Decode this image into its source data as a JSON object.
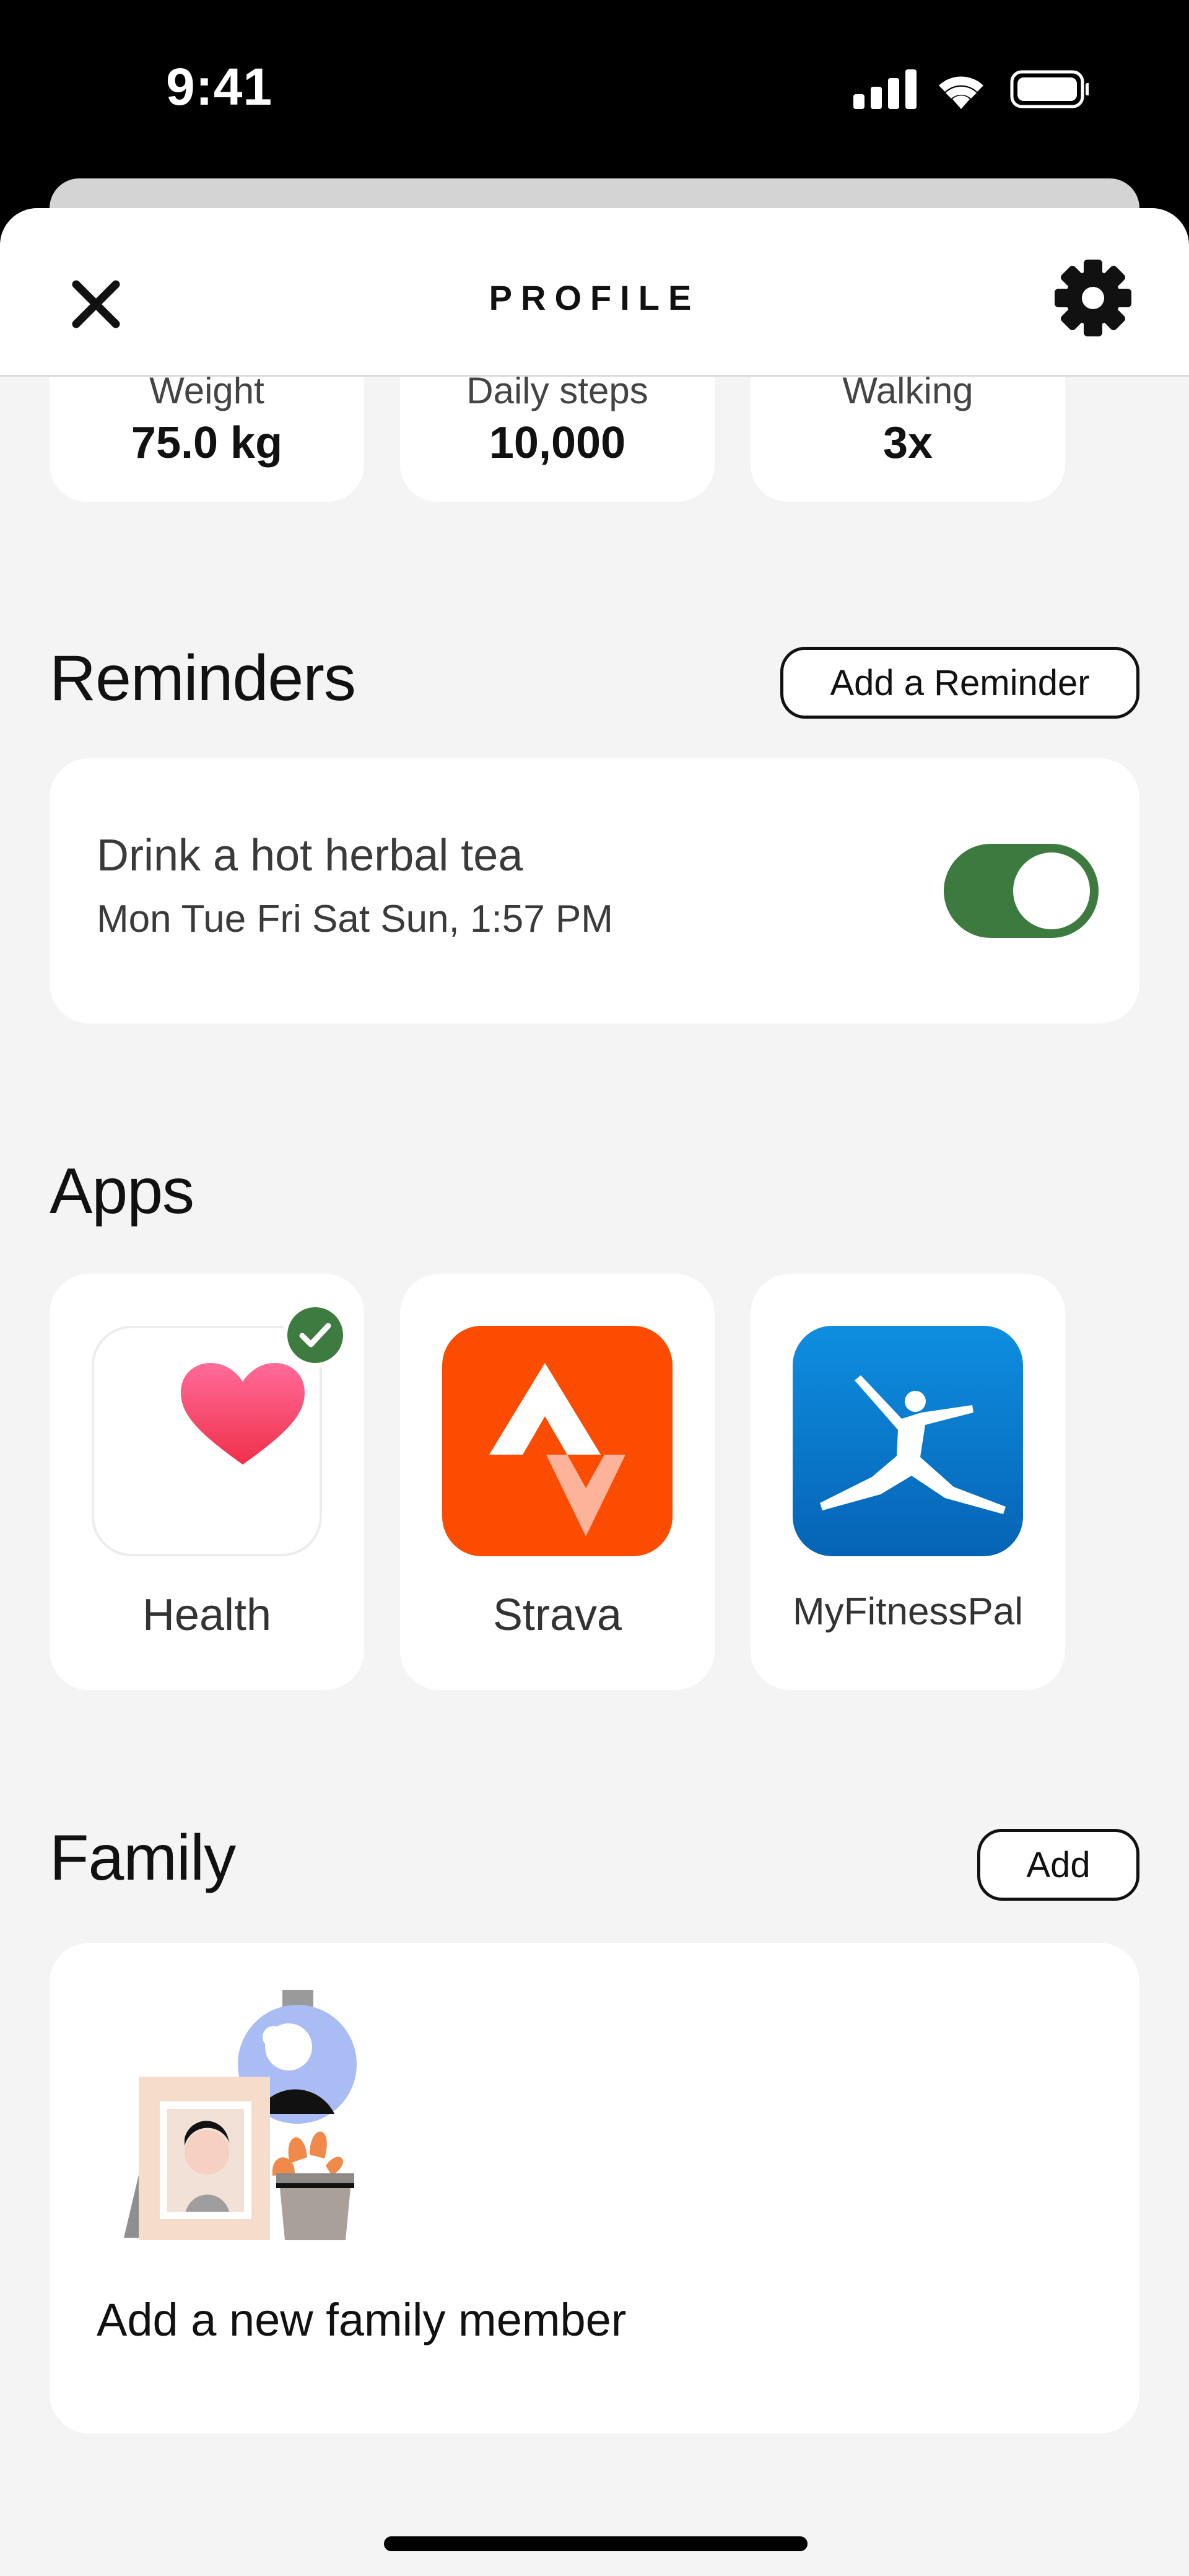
{
  "status_bar": {
    "time": "9:41"
  },
  "header": {
    "title": "PROFILE"
  },
  "stats": [
    {
      "label": "Weight",
      "value": "75.0 kg"
    },
    {
      "label": "Daily steps",
      "value": "10,000"
    },
    {
      "label": "Walking",
      "value": "3x"
    }
  ],
  "reminders": {
    "title": "Reminders",
    "add_label": "Add a Reminder",
    "items": [
      {
        "title": "Drink a hot herbal tea",
        "schedule": "Mon Tue Fri Sat Sun, 1:57 PM",
        "enabled": true
      }
    ]
  },
  "apps": {
    "title": "Apps",
    "items": [
      {
        "name": "Health",
        "connected": true,
        "icon": "heart-icon"
      },
      {
        "name": "Strava",
        "connected": false,
        "icon": "strava-logo"
      },
      {
        "name": "MyFitnessPal",
        "connected": false,
        "icon": "myfitnesspal-logo"
      }
    ]
  },
  "family": {
    "title": "Family",
    "add_label": "Add",
    "cta": "Add a new family member"
  },
  "colors": {
    "accent": "#3d7a3f",
    "background": "#f4f4f4",
    "strava": "#fc4c02",
    "myfitnesspal": "#0a74c8"
  }
}
